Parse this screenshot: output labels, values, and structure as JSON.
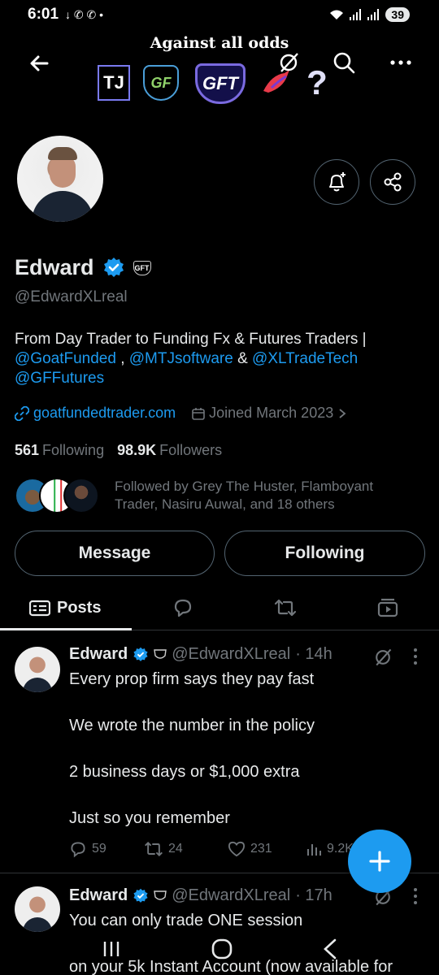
{
  "status_bar": {
    "time": "6:01",
    "left_icons": "↓ ✆ ✆ •",
    "battery": "39"
  },
  "banner": {
    "title": "Against all odds",
    "logos": [
      "TJ",
      "GF",
      "GFT",
      "bird",
      "?"
    ]
  },
  "header": {
    "back_icon": "arrow-left-icon",
    "icons": [
      "grok-icon",
      "search-icon",
      "more-icon"
    ]
  },
  "profile": {
    "name": "Edward",
    "badge_text": "GFT",
    "handle": "@EdwardXLreal",
    "bio_text": "From Day Trader to Funding Fx & Futures Traders |",
    "bio_links": [
      "@GoatFunded",
      "@MTJsoftware",
      "@XLTradeTech",
      "@GFFutures"
    ],
    "bio_sep1": " , ",
    "bio_sep2": " & ",
    "website": "goatfundedtrader.com",
    "joined": "Joined March 2023",
    "following_count": "561",
    "following_label": "Following",
    "followers_count": "98.9K",
    "followers_label": "Followers",
    "followed_by": "Followed by Grey The Huster, Flamboyant Trader, Nasiru Auwal, and 18 others",
    "message_label": "Message",
    "following_button_label": "Following"
  },
  "tabs": {
    "posts_label": "Posts"
  },
  "posts": [
    {
      "name": "Edward",
      "handle": "@EdwardXLreal",
      "time": "· 14h",
      "text": "Every prop firm says they pay fast\n\nWe wrote the number in the policy\n\n2 business days or $1,000 extra\n\nJust so you remember",
      "replies": "59",
      "reposts": "24",
      "likes": "231",
      "views": "9.2K"
    },
    {
      "name": "Edward",
      "handle": "@EdwardXLreal",
      "time": "· 17h",
      "text": "You can only trade ONE session\n\non your 5k Instant Account (now available for"
    }
  ],
  "colors": {
    "accent": "#1d9bf0",
    "background": "#000000",
    "text": "#e7e9ea",
    "muted": "#71767b",
    "border": "#2f3336"
  }
}
